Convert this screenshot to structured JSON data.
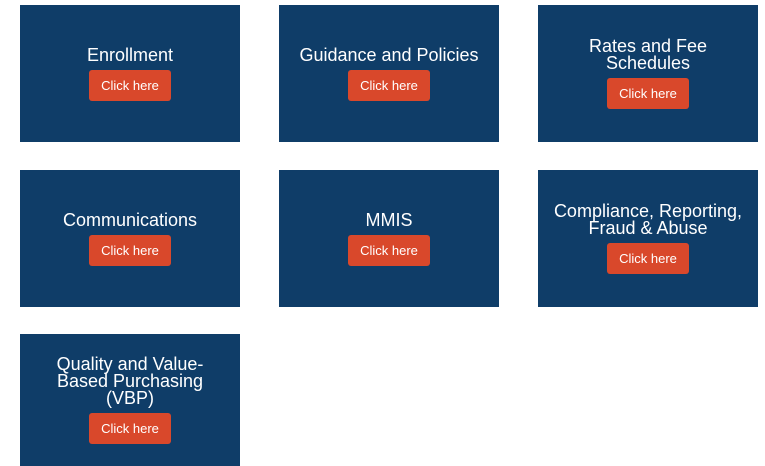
{
  "tiles": [
    {
      "title": "Enrollment",
      "button": "Click here"
    },
    {
      "title": "Guidance and Policies",
      "button": "Click here"
    },
    {
      "title": "Rates and Fee Schedules",
      "button": "Click here"
    },
    {
      "title": "Communications",
      "button": "Click here"
    },
    {
      "title": "MMIS",
      "button": "Click here"
    },
    {
      "title": "Compliance, Reporting, Fraud & Abuse",
      "button": "Click here"
    },
    {
      "title": "Quality and Value-Based Purchasing (VBP)",
      "button": "Click here"
    }
  ],
  "colors": {
    "tile_background": "#0f3d68",
    "button_background": "#d9482b",
    "text": "#ffffff"
  }
}
